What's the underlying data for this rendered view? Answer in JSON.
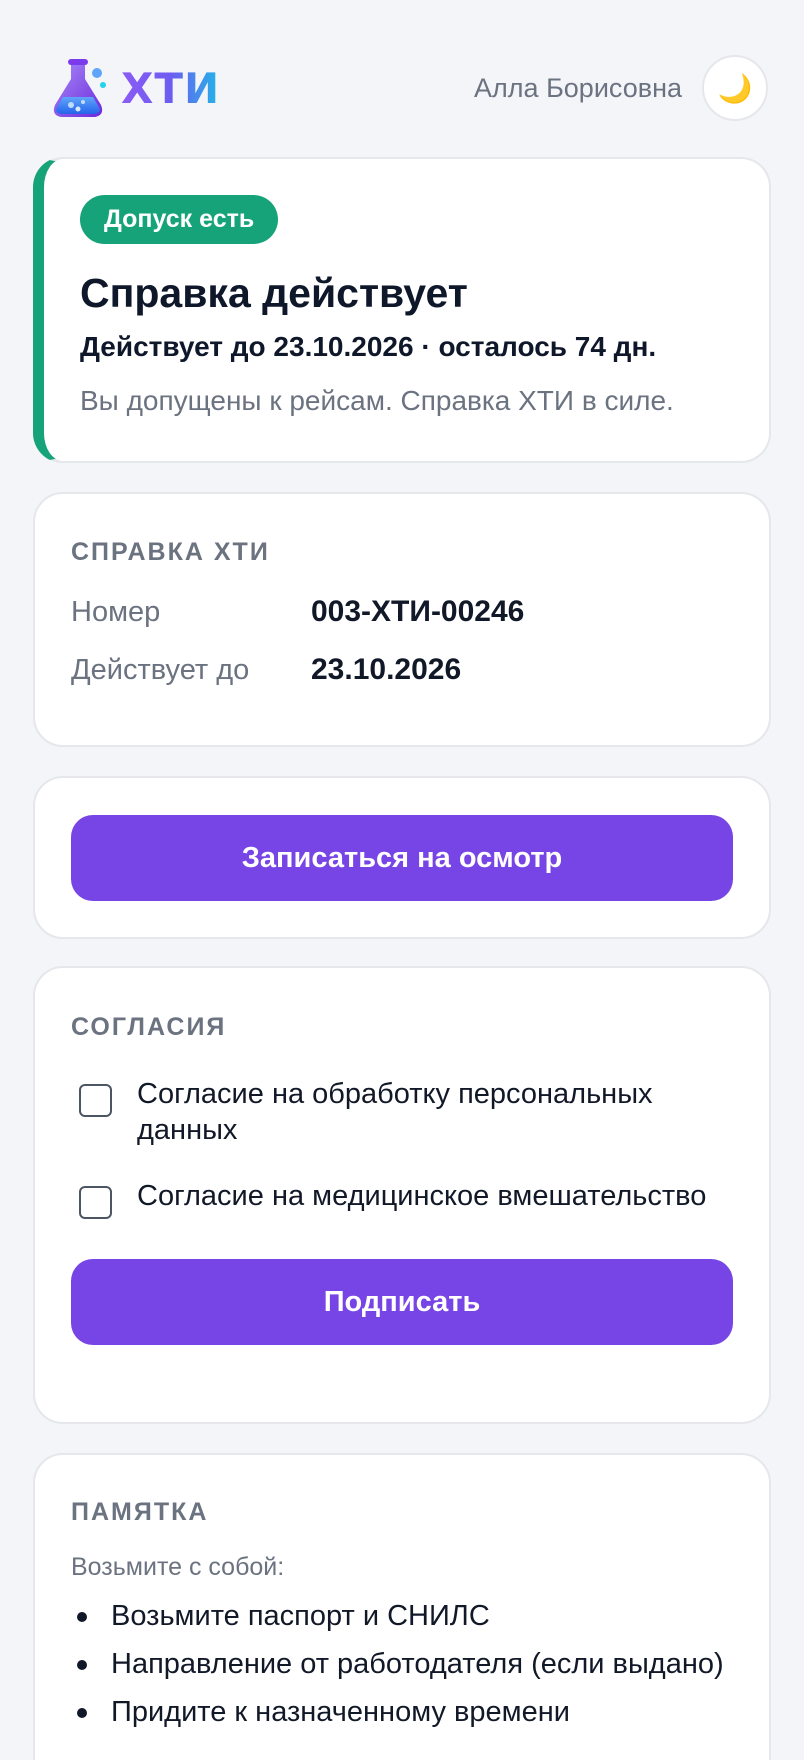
{
  "header": {
    "logo_text": "ХТИ",
    "user_name": "Алла Борисовна",
    "theme_icon": "moon-icon",
    "theme_glyph": "🌙"
  },
  "status": {
    "badge": "Допуск есть",
    "title": "Справка действует",
    "valid_line": "Действует до 23.10.2026 · осталось 74 дн.",
    "note": "Вы допущены к рейсам. Справка ХТИ в силе.",
    "accent_color": "#16a37a"
  },
  "certificate": {
    "section_title": "СПРАВКА ХТИ",
    "rows": [
      {
        "label": "Номер",
        "value": "003-ХТИ-00246"
      },
      {
        "label": "Действует до",
        "value": "23.10.2026"
      }
    ]
  },
  "appointment": {
    "button_label": "Записаться на осмотр",
    "button_color": "#7744e6"
  },
  "consents": {
    "section_title": "СОГЛАСИЯ",
    "items": [
      {
        "label": "Согласие на обработку персональных данных",
        "checked": false
      },
      {
        "label": "Согласие на медицинское вмешательство",
        "checked": false
      }
    ],
    "sign_button": "Подписать"
  },
  "memo": {
    "section_title": "ПАМЯТКА",
    "subtitle": "Возьмите с собой:",
    "items": [
      "Возьмите паспорт и СНИЛС",
      "Направление от работодателя (если выдано)",
      "Придите к назначенному времени"
    ]
  }
}
